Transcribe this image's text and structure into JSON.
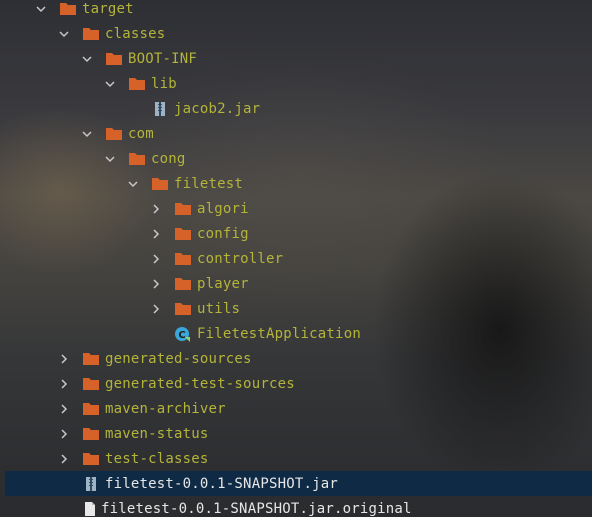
{
  "tree": [
    {
      "label": "target",
      "type": "folder",
      "state": "expanded"
    },
    {
      "label": "classes",
      "type": "folder",
      "state": "expanded"
    },
    {
      "label": "BOOT-INF",
      "type": "folder",
      "state": "expanded"
    },
    {
      "label": "lib",
      "type": "folder",
      "state": "expanded"
    },
    {
      "label": "jacob2.jar",
      "type": "jar"
    },
    {
      "label": "com",
      "type": "folder",
      "state": "expanded"
    },
    {
      "label": "cong",
      "type": "folder",
      "state": "expanded"
    },
    {
      "label": "filetest",
      "type": "folder",
      "state": "expanded"
    },
    {
      "label": "algori",
      "type": "folder",
      "state": "collapsed"
    },
    {
      "label": "config",
      "type": "folder",
      "state": "collapsed"
    },
    {
      "label": "controller",
      "type": "folder",
      "state": "collapsed"
    },
    {
      "label": "player",
      "type": "folder",
      "state": "collapsed"
    },
    {
      "label": "utils",
      "type": "folder",
      "state": "collapsed"
    },
    {
      "label": "FiletestApplication",
      "type": "class"
    },
    {
      "label": "generated-sources",
      "type": "folder",
      "state": "collapsed"
    },
    {
      "label": "generated-test-sources",
      "type": "folder",
      "state": "collapsed"
    },
    {
      "label": "maven-archiver",
      "type": "folder",
      "state": "collapsed"
    },
    {
      "label": "maven-status",
      "type": "folder",
      "state": "collapsed"
    },
    {
      "label": "test-classes",
      "type": "folder",
      "state": "collapsed"
    },
    {
      "label": "filetest-0.0.1-SNAPSHOT.jar",
      "type": "jar",
      "selected": true
    },
    {
      "label": "filetest-0.0.1-SNAPSHOT.jar.original",
      "type": "file"
    }
  ],
  "colors": {
    "folder": "#d6622a",
    "label": "#b4b43a",
    "selection": "#0f2a45",
    "chevron": "#c8c8c8",
    "class_icon": "#3aa7d8"
  }
}
